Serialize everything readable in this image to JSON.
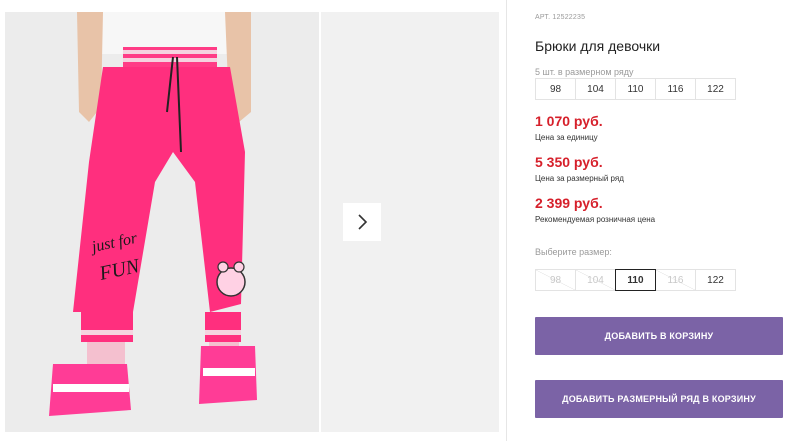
{
  "product": {
    "article": "АРТ. 12522235",
    "title": "Брюки для девочки",
    "pack_label": "5 шт. в размерном ряду",
    "pack_sizes": [
      "98",
      "104",
      "110",
      "116",
      "122"
    ],
    "prices": [
      {
        "value": "1 070 руб.",
        "note": "Цена за единицу"
      },
      {
        "value": "5 350 руб.",
        "note": "Цена за размерный ряд"
      },
      {
        "value": "2 399 руб.",
        "note": "Рекомендуемая розничная цена"
      }
    ],
    "choose_label": "Выберите размер:",
    "select_sizes": [
      {
        "label": "98",
        "state": "disabled"
      },
      {
        "label": "104",
        "state": "disabled"
      },
      {
        "label": "110",
        "state": "selected"
      },
      {
        "label": "116",
        "state": "disabled"
      },
      {
        "label": "122",
        "state": "available"
      }
    ],
    "add_to_cart": "ДОБАВИТЬ В КОРЗИНУ",
    "add_pack_to_cart": "ДОБАВИТЬ РАЗМЕРНЫЙ РЯД В КОРЗИНУ"
  },
  "gallery": {
    "photo_text_1": "just for",
    "photo_text_2": "FUN",
    "next_icon": "chevron-right-icon"
  },
  "colors": {
    "price": "#d6202b",
    "button": "#7b63a6",
    "pants": "#ff2f7e"
  }
}
